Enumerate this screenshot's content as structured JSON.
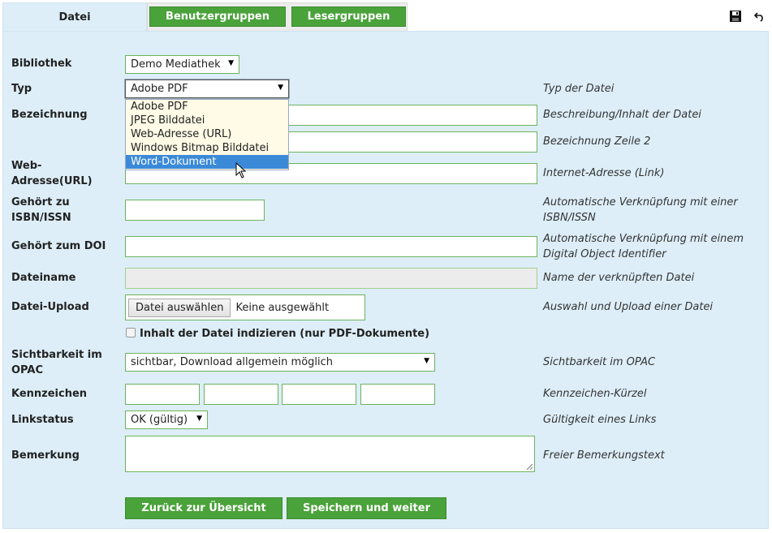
{
  "tabs": {
    "active": "Datei",
    "buttons": [
      "Benutzergruppen",
      "Lesergruppen"
    ]
  },
  "toolbar": {
    "icons": [
      "save-icon",
      "undo-icon"
    ]
  },
  "form": {
    "bibliothek": {
      "label": "Bibliothek",
      "value": "Demo Mediathek"
    },
    "typ": {
      "label": "Typ",
      "value": "Adobe PDF",
      "hint": "Typ der Datei",
      "options": [
        "Adobe PDF",
        "JPEG Bilddatei",
        "Web-Adresse (URL)",
        "Windows Bitmap Bilddatei",
        "Word-Dokument"
      ],
      "highlighted": "Word-Dokument"
    },
    "bezeichnung": {
      "label": "Bezeichnung",
      "hint": "Beschreibung/Inhalt der Datei",
      "hint2": "Bezeichnung Zeile 2"
    },
    "webadresse": {
      "label_line1": "Web-",
      "label_line2": "Adresse(URL)",
      "hint": "Internet-Adresse (Link)"
    },
    "isbn": {
      "label_line1": "Gehört zu",
      "label_line2": "ISBN/ISSN",
      "hint_line1": "Automatische Verknüpfung mit einer",
      "hint_line2": "ISBN/ISSN"
    },
    "doi": {
      "label": "Gehört zum DOI",
      "hint_line1": "Automatische Verknüpfung mit einem",
      "hint_line2": "Digital Object Identifier"
    },
    "dateiname": {
      "label": "Dateiname",
      "hint": "Name der verknüpften Datei"
    },
    "upload": {
      "label": "Datei-Upload",
      "button": "Datei auswählen",
      "status": "Keine ausgewählt",
      "hint": "Auswahl und Upload einer Datei"
    },
    "indizieren": {
      "label": "Inhalt der Datei indizieren (nur PDF-Dokumente)",
      "checked": false
    },
    "sichtbarkeit": {
      "label_line1": "Sichtbarkeit im",
      "label_line2": "OPAC",
      "value": "sichtbar, Download allgemein möglich",
      "hint": "Sichtbarkeit im OPAC"
    },
    "kennzeichen": {
      "label": "Kennzeichen",
      "hint": "Kennzeichen-Kürzel"
    },
    "linkstatus": {
      "label": "Linkstatus",
      "value": "OK (gültig)",
      "hint": "Gültigkeit eines Links"
    },
    "bemerkung": {
      "label": "Bemerkung",
      "hint": "Freier Bemerkungstext"
    }
  },
  "actions": {
    "back": "Zurück zur Übersicht",
    "save": "Speichern und weiter"
  },
  "colors": {
    "accent_green": "#4aa23a",
    "panel_bg": "#ddeef8",
    "selection_blue": "#3b8ad8"
  }
}
